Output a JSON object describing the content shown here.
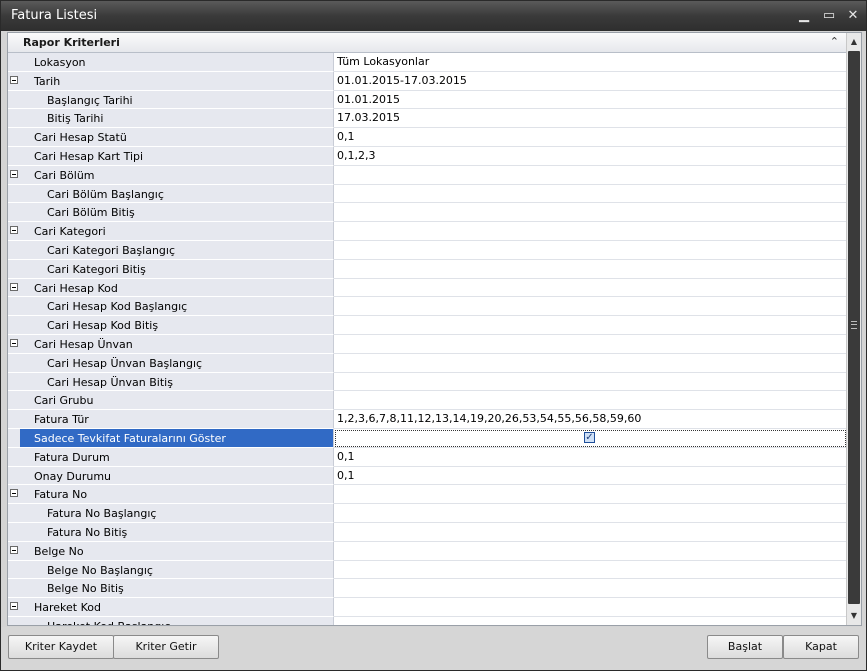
{
  "window": {
    "title": "Fatura Listesi"
  },
  "titlebar_buttons": [
    {
      "name": "minimize-button",
      "glyph": "▁"
    },
    {
      "name": "maximize-button",
      "glyph": "▭"
    },
    {
      "name": "close-button",
      "glyph": "✕"
    }
  ],
  "panel": {
    "header": "Rapor Kriterleri",
    "collapse_icon": "chevron-double-up-icon",
    "collapse_glyph": "⌃"
  },
  "rows": [
    {
      "label": "Lokasyon",
      "value": "Tüm Lokasyonlar",
      "level": 0,
      "expander": false
    },
    {
      "label": "Tarih",
      "value": "01.01.2015-17.03.2015",
      "level": 0,
      "expander": true
    },
    {
      "label": "Başlangıç Tarihi",
      "value": "01.01.2015",
      "level": 1,
      "expander": false
    },
    {
      "label": "Bitiş Tarihi",
      "value": "17.03.2015",
      "level": 1,
      "expander": false
    },
    {
      "label": "Cari Hesap Statü",
      "value": "0,1",
      "level": 0,
      "expander": false
    },
    {
      "label": "Cari Hesap Kart Tipi",
      "value": "0,1,2,3",
      "level": 0,
      "expander": false
    },
    {
      "label": "Cari Bölüm",
      "value": "",
      "level": 0,
      "expander": true
    },
    {
      "label": "Cari Bölüm Başlangıç",
      "value": "",
      "level": 1,
      "expander": false
    },
    {
      "label": "Cari Bölüm Bitiş",
      "value": "",
      "level": 1,
      "expander": false
    },
    {
      "label": "Cari Kategori",
      "value": "",
      "level": 0,
      "expander": true
    },
    {
      "label": "Cari Kategori Başlangıç",
      "value": "",
      "level": 1,
      "expander": false
    },
    {
      "label": "Cari Kategori Bitiş",
      "value": "",
      "level": 1,
      "expander": false
    },
    {
      "label": "Cari Hesap Kod",
      "value": "",
      "level": 0,
      "expander": true
    },
    {
      "label": "Cari Hesap Kod Başlangıç",
      "value": "",
      "level": 1,
      "expander": false
    },
    {
      "label": "Cari Hesap Kod Bitiş",
      "value": "",
      "level": 1,
      "expander": false
    },
    {
      "label": "Cari Hesap Ünvan",
      "value": "",
      "level": 0,
      "expander": true
    },
    {
      "label": "Cari Hesap Ünvan Başlangıç",
      "value": "",
      "level": 1,
      "expander": false
    },
    {
      "label": "Cari Hesap Ünvan Bitiş",
      "value": "",
      "level": 1,
      "expander": false
    },
    {
      "label": "Cari Grubu",
      "value": "",
      "level": 0,
      "expander": false
    },
    {
      "label": "Fatura Tür",
      "value": "1,2,3,6,7,8,11,12,13,14,19,20,26,53,54,55,56,58,59,60",
      "level": 0,
      "expander": false
    },
    {
      "label": "Sadece Tevkifat Faturalarını Göster",
      "value": "",
      "level": 0,
      "expander": false,
      "selected": true,
      "checkbox": true,
      "checked": true
    },
    {
      "label": "Fatura Durum",
      "value": "0,1",
      "level": 0,
      "expander": false
    },
    {
      "label": "Onay Durumu",
      "value": "0,1",
      "level": 0,
      "expander": false
    },
    {
      "label": "Fatura No",
      "value": "",
      "level": 0,
      "expander": true
    },
    {
      "label": "Fatura No Başlangıç",
      "value": "",
      "level": 1,
      "expander": false
    },
    {
      "label": "Fatura No Bitiş",
      "value": "",
      "level": 1,
      "expander": false
    },
    {
      "label": "Belge No",
      "value": "",
      "level": 0,
      "expander": true
    },
    {
      "label": "Belge No Başlangıç",
      "value": "",
      "level": 1,
      "expander": false
    },
    {
      "label": "Belge No Bitiş",
      "value": "",
      "level": 1,
      "expander": false
    },
    {
      "label": "Hareket Kod",
      "value": "",
      "level": 0,
      "expander": true
    },
    {
      "label": "Hareket Kod Başlangıç",
      "value": "",
      "level": 1,
      "expander": false
    }
  ],
  "footer": {
    "save_criteria": "Kriter Kaydet",
    "load_criteria": "Kriter Getir",
    "start": "Başlat",
    "close": "Kapat"
  }
}
